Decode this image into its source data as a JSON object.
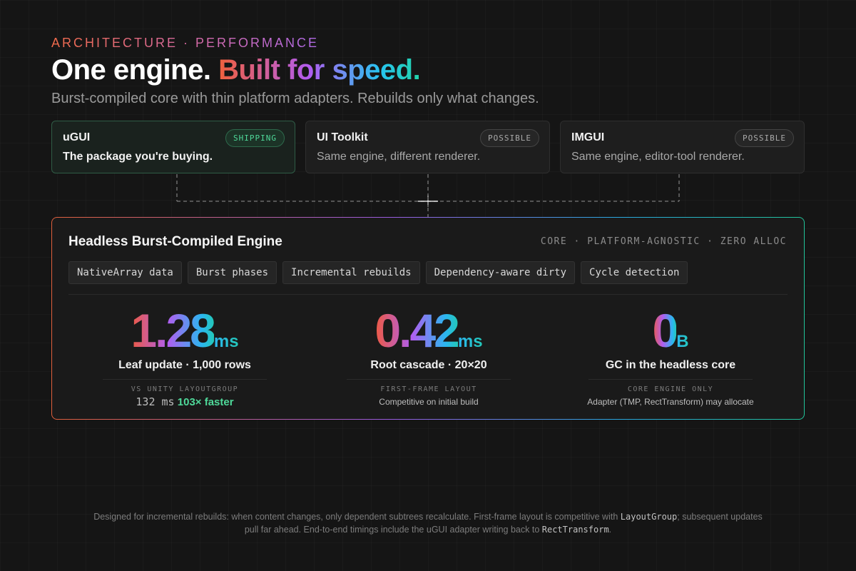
{
  "header": {
    "eyebrow": "ARCHITECTURE · PERFORMANCE",
    "headline_plain": "One engine.",
    "headline_accent": "Built for speed.",
    "subtitle": "Burst-compiled core with thin platform adapters. Rebuilds only what changes."
  },
  "renderers": [
    {
      "title": "uGUI",
      "badge": "SHIPPING",
      "description": "The package you're buying."
    },
    {
      "title": "UI Toolkit",
      "badge": "POSSIBLE",
      "description": "Same engine, different renderer."
    },
    {
      "title": "IMGUI",
      "badge": "POSSIBLE",
      "description": "Same engine, editor-tool renderer."
    }
  ],
  "engine": {
    "title": "Headless Burst-Compiled Engine",
    "meta": "CORE · PLATFORM-AGNOSTIC · ZERO ALLOC",
    "features": [
      "NativeArray data",
      "Burst phases",
      "Incremental rebuilds",
      "Dependency-aware dirty",
      "Cycle detection"
    ]
  },
  "metrics": [
    {
      "value": "1.28",
      "unit": "ms",
      "label": "Leaf update · 1,000 rows",
      "caption": "VS UNITY LAYOUTGROUP",
      "baseline": "132 ms",
      "speedup": "103× faster"
    },
    {
      "value": "0.42",
      "unit": "ms",
      "label": "Root cascade · 20×20",
      "caption": "FIRST-FRAME LAYOUT",
      "note": "Competitive on initial build"
    },
    {
      "value": "0",
      "unit": "B",
      "label": "GC in the headless core",
      "caption": "CORE ENGINE ONLY",
      "note": "Adapter (TMP, RectTransform) may allocate"
    }
  ],
  "footer": {
    "part1": "Designed for incremental rebuilds: when content changes, only dependent subtrees recalculate. First-frame layout is competitive with ",
    "code1": "LayoutGroup",
    "part2": "; subsequent updates pull far ahead. End-to-end timings include the uGUI adapter writing back to ",
    "code2": "RectTransform",
    "part3": "."
  },
  "colors": {
    "shipping": "#4fd99a",
    "gradient_start": "#f0603c",
    "gradient_mid": "#b25cf0",
    "gradient_end": "#27c4f0",
    "background": "#151515"
  }
}
